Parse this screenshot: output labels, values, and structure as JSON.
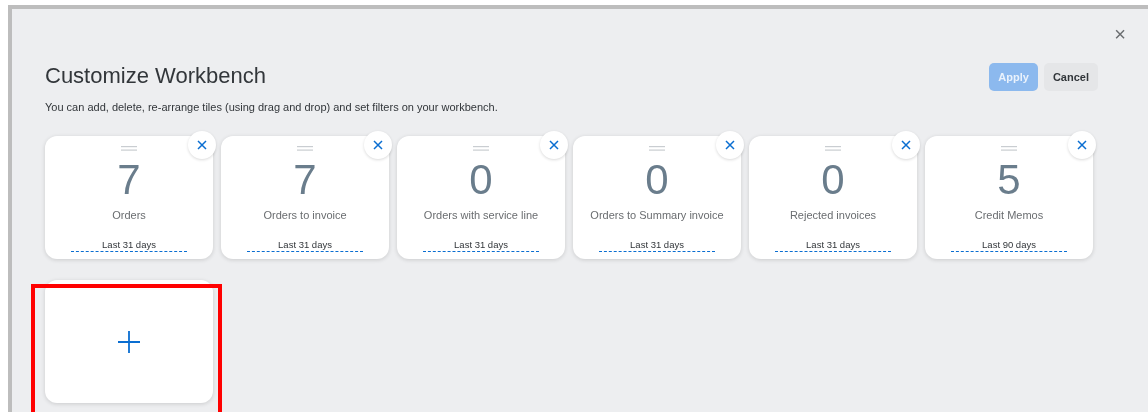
{
  "dialog": {
    "title": "Customize Workbench",
    "description": "You can add, delete, re-arrange tiles (using drag and drop) and set filters on your workbench.",
    "close": "×",
    "buttons": [
      {
        "kind": "primary",
        "label": "Apply",
        "disabled": true
      },
      {
        "kind": "secondary",
        "label": "Cancel"
      }
    ]
  },
  "tiles": [
    {
      "value": "7",
      "label": "Orders",
      "filter": "Last 31 days"
    },
    {
      "value": "7",
      "label": "Orders to invoice",
      "filter": "Last 31 days"
    },
    {
      "value": "0",
      "label": "Orders with service line",
      "filter": "Last 31 days"
    },
    {
      "value": "0",
      "label": "Orders to Summary invoice",
      "filter": "Last 31 days"
    },
    {
      "value": "0",
      "label": "Rejected invoices",
      "filter": "Last 31 days"
    },
    {
      "value": "5",
      "label": "Credit Memos",
      "filter": "Last 90 days"
    }
  ],
  "add_tile": {
    "highlighted": true
  }
}
